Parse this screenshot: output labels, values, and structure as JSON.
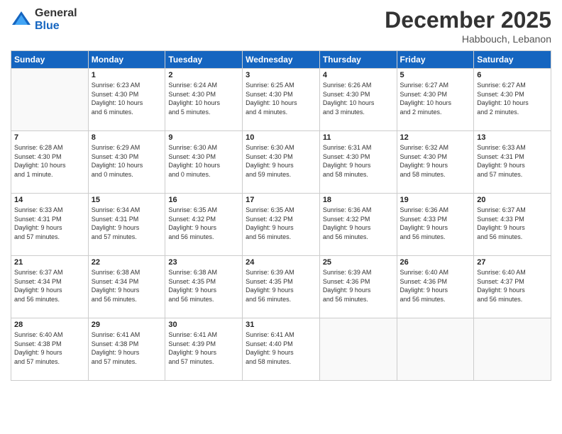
{
  "logo": {
    "general": "General",
    "blue": "Blue"
  },
  "header": {
    "month": "December 2025",
    "location": "Habbouch, Lebanon"
  },
  "days_of_week": [
    "Sunday",
    "Monday",
    "Tuesday",
    "Wednesday",
    "Thursday",
    "Friday",
    "Saturday"
  ],
  "weeks": [
    [
      {
        "day": "",
        "info": ""
      },
      {
        "day": "1",
        "info": "Sunrise: 6:23 AM\nSunset: 4:30 PM\nDaylight: 10 hours\nand 6 minutes."
      },
      {
        "day": "2",
        "info": "Sunrise: 6:24 AM\nSunset: 4:30 PM\nDaylight: 10 hours\nand 5 minutes."
      },
      {
        "day": "3",
        "info": "Sunrise: 6:25 AM\nSunset: 4:30 PM\nDaylight: 10 hours\nand 4 minutes."
      },
      {
        "day": "4",
        "info": "Sunrise: 6:26 AM\nSunset: 4:30 PM\nDaylight: 10 hours\nand 3 minutes."
      },
      {
        "day": "5",
        "info": "Sunrise: 6:27 AM\nSunset: 4:30 PM\nDaylight: 10 hours\nand 2 minutes."
      },
      {
        "day": "6",
        "info": "Sunrise: 6:27 AM\nSunset: 4:30 PM\nDaylight: 10 hours\nand 2 minutes."
      }
    ],
    [
      {
        "day": "7",
        "info": "Sunrise: 6:28 AM\nSunset: 4:30 PM\nDaylight: 10 hours\nand 1 minute."
      },
      {
        "day": "8",
        "info": "Sunrise: 6:29 AM\nSunset: 4:30 PM\nDaylight: 10 hours\nand 0 minutes."
      },
      {
        "day": "9",
        "info": "Sunrise: 6:30 AM\nSunset: 4:30 PM\nDaylight: 10 hours\nand 0 minutes."
      },
      {
        "day": "10",
        "info": "Sunrise: 6:30 AM\nSunset: 4:30 PM\nDaylight: 9 hours\nand 59 minutes."
      },
      {
        "day": "11",
        "info": "Sunrise: 6:31 AM\nSunset: 4:30 PM\nDaylight: 9 hours\nand 58 minutes."
      },
      {
        "day": "12",
        "info": "Sunrise: 6:32 AM\nSunset: 4:30 PM\nDaylight: 9 hours\nand 58 minutes."
      },
      {
        "day": "13",
        "info": "Sunrise: 6:33 AM\nSunset: 4:31 PM\nDaylight: 9 hours\nand 57 minutes."
      }
    ],
    [
      {
        "day": "14",
        "info": "Sunrise: 6:33 AM\nSunset: 4:31 PM\nDaylight: 9 hours\nand 57 minutes."
      },
      {
        "day": "15",
        "info": "Sunrise: 6:34 AM\nSunset: 4:31 PM\nDaylight: 9 hours\nand 57 minutes."
      },
      {
        "day": "16",
        "info": "Sunrise: 6:35 AM\nSunset: 4:32 PM\nDaylight: 9 hours\nand 56 minutes."
      },
      {
        "day": "17",
        "info": "Sunrise: 6:35 AM\nSunset: 4:32 PM\nDaylight: 9 hours\nand 56 minutes."
      },
      {
        "day": "18",
        "info": "Sunrise: 6:36 AM\nSunset: 4:32 PM\nDaylight: 9 hours\nand 56 minutes."
      },
      {
        "day": "19",
        "info": "Sunrise: 6:36 AM\nSunset: 4:33 PM\nDaylight: 9 hours\nand 56 minutes."
      },
      {
        "day": "20",
        "info": "Sunrise: 6:37 AM\nSunset: 4:33 PM\nDaylight: 9 hours\nand 56 minutes."
      }
    ],
    [
      {
        "day": "21",
        "info": "Sunrise: 6:37 AM\nSunset: 4:34 PM\nDaylight: 9 hours\nand 56 minutes."
      },
      {
        "day": "22",
        "info": "Sunrise: 6:38 AM\nSunset: 4:34 PM\nDaylight: 9 hours\nand 56 minutes."
      },
      {
        "day": "23",
        "info": "Sunrise: 6:38 AM\nSunset: 4:35 PM\nDaylight: 9 hours\nand 56 minutes."
      },
      {
        "day": "24",
        "info": "Sunrise: 6:39 AM\nSunset: 4:35 PM\nDaylight: 9 hours\nand 56 minutes."
      },
      {
        "day": "25",
        "info": "Sunrise: 6:39 AM\nSunset: 4:36 PM\nDaylight: 9 hours\nand 56 minutes."
      },
      {
        "day": "26",
        "info": "Sunrise: 6:40 AM\nSunset: 4:36 PM\nDaylight: 9 hours\nand 56 minutes."
      },
      {
        "day": "27",
        "info": "Sunrise: 6:40 AM\nSunset: 4:37 PM\nDaylight: 9 hours\nand 56 minutes."
      }
    ],
    [
      {
        "day": "28",
        "info": "Sunrise: 6:40 AM\nSunset: 4:38 PM\nDaylight: 9 hours\nand 57 minutes."
      },
      {
        "day": "29",
        "info": "Sunrise: 6:41 AM\nSunset: 4:38 PM\nDaylight: 9 hours\nand 57 minutes."
      },
      {
        "day": "30",
        "info": "Sunrise: 6:41 AM\nSunset: 4:39 PM\nDaylight: 9 hours\nand 57 minutes."
      },
      {
        "day": "31",
        "info": "Sunrise: 6:41 AM\nSunset: 4:40 PM\nDaylight: 9 hours\nand 58 minutes."
      },
      {
        "day": "",
        "info": ""
      },
      {
        "day": "",
        "info": ""
      },
      {
        "day": "",
        "info": ""
      }
    ]
  ]
}
